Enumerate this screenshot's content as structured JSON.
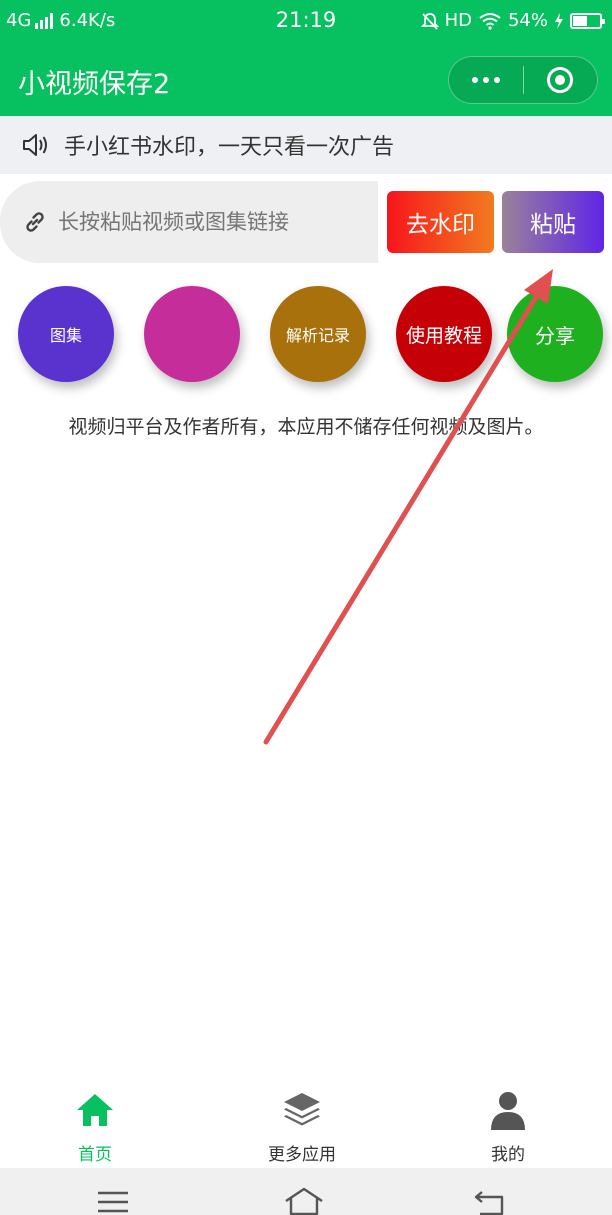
{
  "status_bar": {
    "network": "4G",
    "speed": "6.4K/s",
    "time": "21:19",
    "hd": "HD",
    "battery": "54%",
    "battery_level": 0.54
  },
  "header": {
    "title": "小视频保存2"
  },
  "notice": {
    "text": "手小红书水印，一天只看一次广告"
  },
  "link_input": {
    "placeholder": "长按粘贴视频或图集链接"
  },
  "buttons": {
    "remove_watermark": "去水印",
    "paste": "粘贴"
  },
  "circles": [
    {
      "label": "图集",
      "color": "#5a33cf"
    },
    {
      "label": "",
      "color": "#c52e9a"
    },
    {
      "label": "解析记录",
      "color": "#a8710b"
    },
    {
      "label": "使用教程",
      "color": "#c50006"
    },
    {
      "label": "分享",
      "color": "#1fb020"
    }
  ],
  "disclaimer": "视频归平台及作者所有，本应用不储存任何视频及图片。",
  "tabbar": {
    "items": [
      {
        "label": "首页",
        "icon": "home-icon",
        "active": true
      },
      {
        "label": "更多应用",
        "icon": "layers-icon",
        "active": false
      },
      {
        "label": "我的",
        "icon": "user-icon",
        "active": false
      }
    ]
  },
  "colors": {
    "brand": "#07c160",
    "annotation_arrow": "#e05050"
  }
}
